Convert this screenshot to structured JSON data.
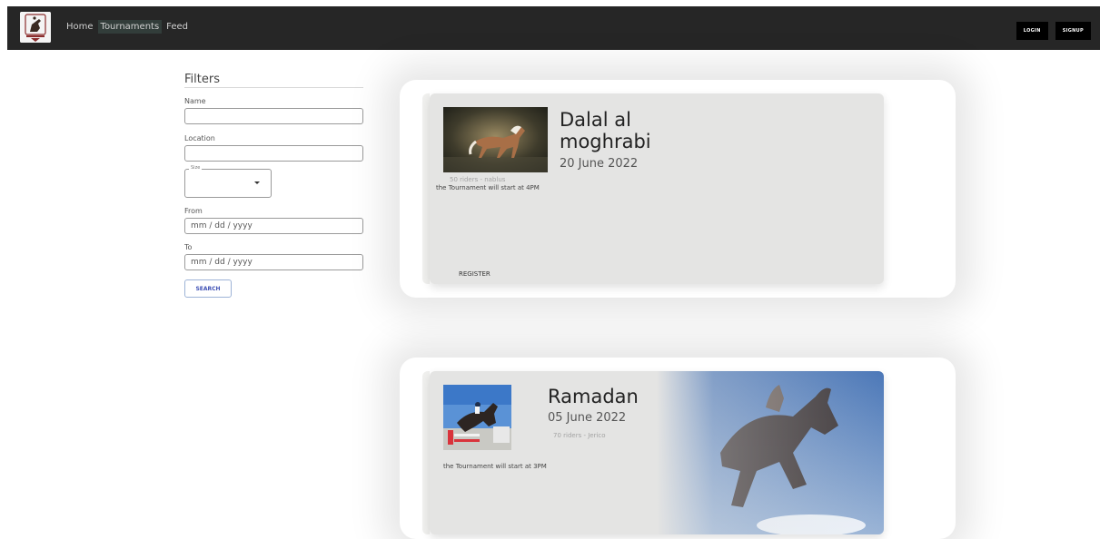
{
  "navbar": {
    "links": [
      {
        "label": "Home",
        "active": false
      },
      {
        "label": "Tournaments",
        "active": true
      },
      {
        "label": "Feed",
        "active": false
      }
    ],
    "login_label": "LOGIN",
    "signup_label": "SIGNUP"
  },
  "filters": {
    "title": "Filters",
    "name_label": "Name",
    "name_value": "",
    "location_label": "Location",
    "location_value": "",
    "size_label": "Size",
    "size_value": "",
    "from_label": "From",
    "from_placeholder": "mm / dd / yyyy",
    "to_label": "To",
    "to_placeholder": "mm / dd / yyyy",
    "search_label": "SEARCH"
  },
  "tournaments": [
    {
      "title_line1": "Dalal al",
      "title_line2": "moghrabi",
      "date": "20 June 2022",
      "meta": "50 riders - nablus",
      "description": "the Tournament will start at 4PM",
      "register_label": "REGISTER"
    },
    {
      "title": "Ramadan",
      "date": "05 June 2022",
      "meta": "70 riders - Jerico",
      "description": "the Tournament will start at 3PM"
    }
  ],
  "colors": {
    "navbar_bg": "#262626",
    "card_bg": "#e4e4e3",
    "search_accent": "#3f51b5"
  }
}
